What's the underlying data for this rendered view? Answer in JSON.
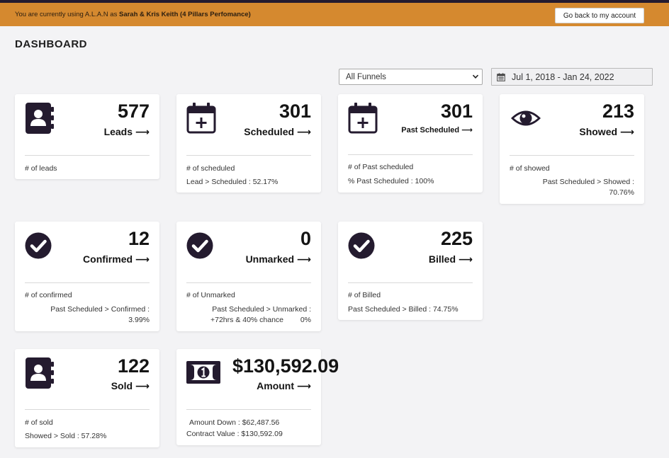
{
  "banner": {
    "prefix": "You are currently using A.L.A.N as ",
    "account": "Sarah & Kris Keith (4 Pillars Perfomance)",
    "back_button": "Go back to my account"
  },
  "title": "DASHBOARD",
  "filters": {
    "funnel_selected": "All Funnels",
    "date_range": "Jul 1, 2018 - Jan 24, 2022"
  },
  "cards": {
    "leads": {
      "value": "577",
      "label": "Leads",
      "arrow": "⟶",
      "sub1": "# of leads"
    },
    "scheduled": {
      "value": "301",
      "label": "Scheduled",
      "arrow": "⟶",
      "sub1": "# of scheduled",
      "sub2": "Lead > Scheduled : 52.17%"
    },
    "past_scheduled": {
      "value": "301",
      "label": "Past Scheduled",
      "arrow": "⟶",
      "sub1": "# of Past scheduled",
      "sub2": "% Past Scheduled : 100%"
    },
    "showed": {
      "value": "213",
      "label": "Showed",
      "arrow": "⟶",
      "sub1": "# of showed",
      "sub2": "Past Scheduled > Showed :",
      "sub3": "70.76%"
    },
    "confirmed": {
      "value": "12",
      "label": "Confirmed",
      "arrow": "⟶",
      "sub1": "# of confirmed",
      "sub2": "Past Scheduled > Confirmed :",
      "sub3": "3.99%"
    },
    "unmarked": {
      "value": "0",
      "label": "Unmarked",
      "arrow": "⟶",
      "sub1": "# of Unmarked",
      "sub2": "Past Scheduled > Unmarked :",
      "sub3": "+72hrs & 40% chance",
      "sub4": "0%"
    },
    "billed": {
      "value": "225",
      "label": "Billed",
      "arrow": "⟶",
      "sub1": "# of Billed",
      "sub2": "Past Scheduled > Billed : 74.75%"
    },
    "sold": {
      "value": "122",
      "label": "Sold",
      "arrow": "⟶",
      "sub1": "# of sold",
      "sub2": "Showed > Sold : 57.28%"
    },
    "amount": {
      "value": "$130,592.09",
      "label": "Amount",
      "arrow": "⟶",
      "sub1": "Amount Down : $62,487.56",
      "sub2": "Contract Value : $130,592.09"
    }
  },
  "colors": {
    "banner": "#d5892f",
    "icon": "#241b2f",
    "top_line": "#241b2f"
  }
}
